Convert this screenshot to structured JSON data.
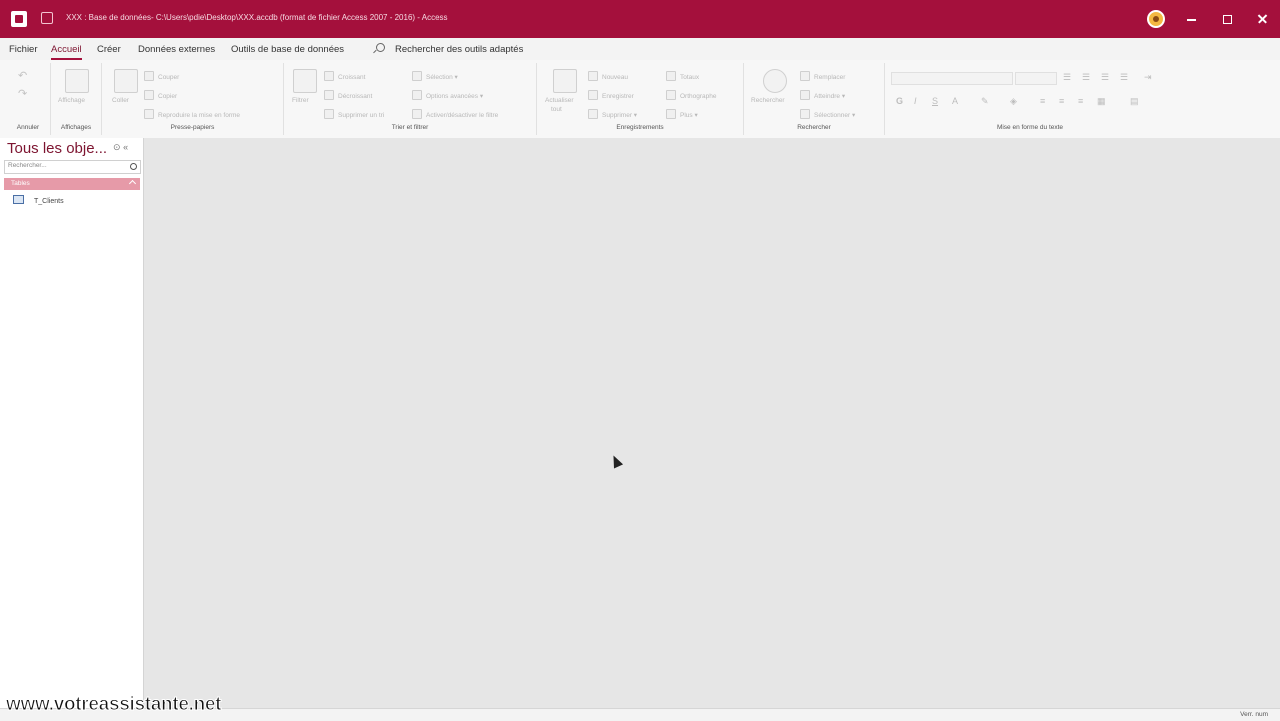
{
  "window": {
    "title": "XXX : Base de données- C:\\Users\\pdie\\Desktop\\XXX.accdb (format de fichier Access 2007 - 2016) - Access"
  },
  "menu": {
    "tabs": [
      {
        "label": "Fichier"
      },
      {
        "label": "Accueil",
        "active": true
      },
      {
        "label": "Créer"
      },
      {
        "label": "Données externes"
      },
      {
        "label": "Outils de base de données"
      }
    ],
    "search_label": "Rechercher des outils adaptés"
  },
  "ribbon": {
    "groups": {
      "annuler": "Annuler",
      "affichages": "Affichages",
      "presse_papiers": "Presse-papiers",
      "trier_filtrer": "Trier et filtrer",
      "enregistrements": "Enregistrements",
      "rechercher": "Rechercher",
      "mise_en_forme": "Mise en forme du texte"
    },
    "buttons": {
      "affichage": "Affichage",
      "coller": "Coller",
      "couper": "Couper",
      "copier": "Copier",
      "reproduire": "Reproduire la mise en forme",
      "filtrer": "Filtrer",
      "croissant": "Croissant",
      "decroissant": "Décroissant",
      "supprimer_tri": "Supprimer un tri",
      "selection": "Sélection",
      "options_avancees": "Options avancées",
      "activer_filtre": "Activer/désactiver le filtre",
      "actualiser": "Actualiser",
      "actualiser_sub": "tout",
      "nouveau": "Nouveau",
      "enregistrer": "Enregistrer",
      "supprimer": "Supprimer",
      "totaux": "Totaux",
      "orthographe": "Orthographe",
      "plus": "Plus",
      "rechercher": "Rechercher",
      "remplacer": "Remplacer",
      "atteindre": "Atteindre",
      "selectionner": "Sélectionner"
    }
  },
  "nav": {
    "title": "Tous les obje...",
    "search_placeholder": "Rechercher...",
    "group_label": "Tables",
    "objects": [
      {
        "label": "T_Clients"
      }
    ]
  },
  "status": {
    "num_lock": "Verr. num"
  },
  "watermark": "www.votreassistante.net"
}
